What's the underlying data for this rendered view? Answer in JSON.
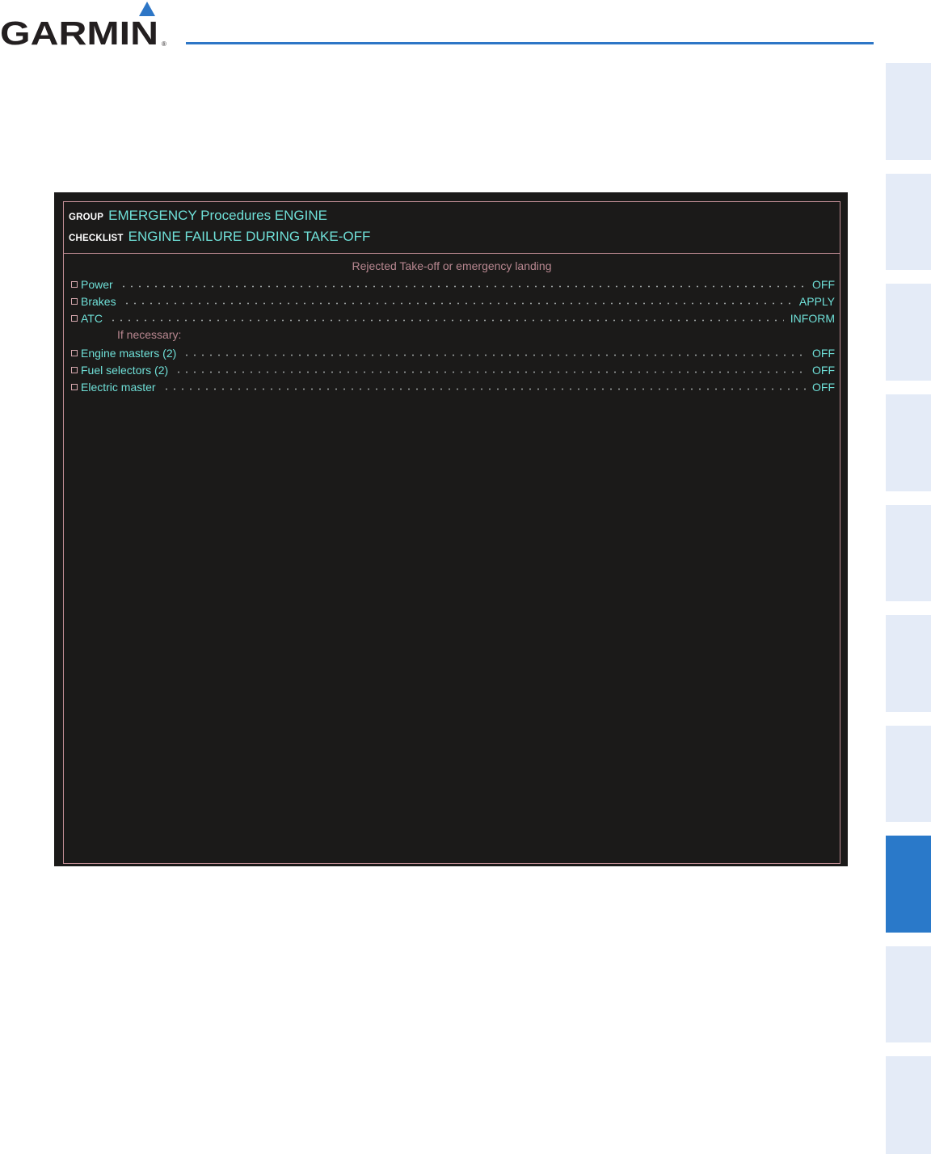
{
  "brand": {
    "name": "GARMIN",
    "accent": "#2d76c6"
  },
  "side_tabs": {
    "count": 10,
    "active_index": 7,
    "active_color": "#2a79c9",
    "inactive_color": "#e4ebf7"
  },
  "checklist_screen": {
    "group_label": "GROUP",
    "group_value": "EMERGENCY Procedures ENGINE",
    "checklist_label": "CHECKLIST",
    "checklist_value": "ENGINE FAILURE DURING TAKE-OFF",
    "note_top": "Rejected Take-off or emergency landing",
    "note_conditional": "If necessary:",
    "items": [
      {
        "label": "Power",
        "value": "OFF"
      },
      {
        "label": "Brakes",
        "value": "APPLY"
      },
      {
        "label": "ATC",
        "value": "INFORM"
      },
      {
        "label": "Engine masters (2)",
        "value": "OFF"
      },
      {
        "label": "Fuel selectors (2)",
        "value": "OFF"
      },
      {
        "label": "Electric master",
        "value": "OFF"
      }
    ],
    "colors": {
      "text_cyan": "#6fe0d8",
      "note_pink": "#b88790",
      "border": "#c08d94",
      "background": "#1b1a19"
    }
  }
}
